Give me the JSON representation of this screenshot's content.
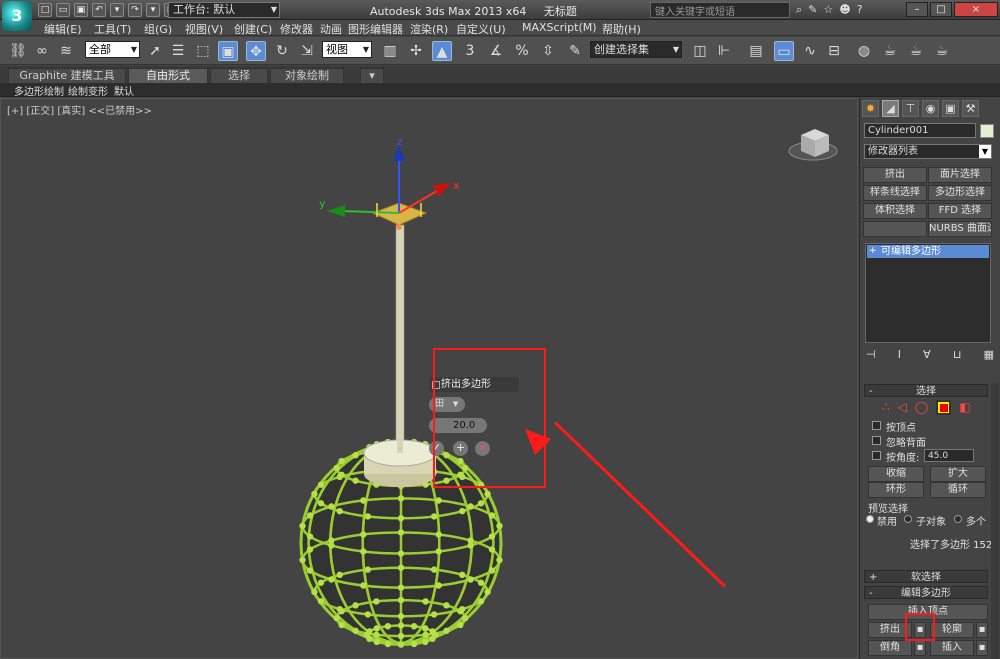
{
  "titlebar": {
    "logo": "3",
    "workspace_label": "工作台: 默认",
    "app_name": "Autodesk 3ds Max  2013 x64",
    "doc_name": "无标题",
    "search_placeholder": "键入关键字或短语"
  },
  "menu": [
    "编辑(E)",
    "工具(T)",
    "组(G)",
    "视图(V)",
    "创建(C)",
    "修改器",
    "动画",
    "图形编辑器",
    "渲染(R)",
    "自定义(U)",
    "MAXScript(M)",
    "帮助(H)"
  ],
  "toolbar": {
    "filter_value": "全部",
    "ref_coord_value": "视图",
    "selection_set_placeholder": "创建选择集",
    "snap_percent_label": "%",
    "snap_num_label": "3"
  },
  "ribbon": {
    "tabs": [
      "Graphite 建模工具",
      "自由形式",
      "选择",
      "对象绘制"
    ],
    "active_tab": "自由形式",
    "sub_items": [
      "多边形绘制",
      "绘制变形",
      "默认"
    ]
  },
  "viewport": {
    "label": "[+] [正交] [真实]  <<已禁用>>",
    "axis_x": "x",
    "axis_y": "y",
    "axis_z": "z"
  },
  "caddy": {
    "title": "挤出多边形",
    "type_value": "田",
    "amount_value": "20.0",
    "ok_symbol": "✓",
    "apply_symbol": "+",
    "cancel_symbol": "×"
  },
  "panel": {
    "object_name": "Cylinder001",
    "modifier_list": "修改器列表",
    "modifier_buttons": [
      "挤出",
      "面片选择",
      "样条线选择",
      "多边形选择",
      "体积选择",
      "FFD 选择",
      "",
      "NURBS 曲面选择"
    ],
    "stack_item": "可编辑多边形",
    "rollout_select": "选择",
    "by_vertex": "按顶点",
    "ignore_backfacing": "忽略背面",
    "by_angle": "按角度:",
    "angle_value": "45.0",
    "shrink": "收缩",
    "grow": "扩大",
    "ring": "环形",
    "loop": "循环",
    "preview_select": "预览选择",
    "preview_options": [
      "禁用",
      "子对象",
      "多个"
    ],
    "selected_status": "选择了多边形 152",
    "rollout_soft": "软选择",
    "rollout_edit": "编辑多边形",
    "insert_vertex": "插入顶点",
    "extrude": "挤出",
    "outline": "轮廓",
    "bevel": "倒角",
    "inset": "插入"
  },
  "colors": {
    "accent_blue": "#5c8bd6",
    "highlight_red": "#ff1a1a",
    "sphere_green": "#9acd32",
    "gizmo_yellow": "#e8c24a"
  }
}
